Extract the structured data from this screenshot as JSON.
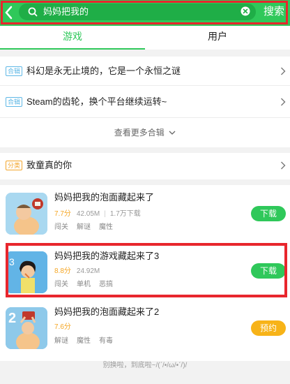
{
  "header": {
    "search_query": "妈妈把我的",
    "search_button": "搜索"
  },
  "tabs": [
    {
      "label": "游戏",
      "active": true
    },
    {
      "label": "用户",
      "active": false
    }
  ],
  "collections": [
    {
      "tag": "合辑",
      "title": "科幻是永无止境的，它是一个永恒之谜"
    },
    {
      "tag": "合辑",
      "title": "Steam的齿轮，换个平台继续运转~"
    }
  ],
  "more_collections": "查看更多合辑",
  "category": {
    "tag": "分类",
    "title": "致童真的你"
  },
  "games": [
    {
      "name": "妈妈把我的泡面藏起来了",
      "score": "7.7分",
      "size": "42.05M",
      "downloads": "1.7万下载",
      "tags": [
        "闯关",
        "解谜",
        "魔性"
      ],
      "action": "下载",
      "action_type": "download"
    },
    {
      "name": "妈妈把我的游戏藏起来了3",
      "score": "8.8分",
      "size": "24.92M",
      "downloads": "",
      "tags": [
        "闯关",
        "单机",
        "恶搞"
      ],
      "action": "下载",
      "action_type": "download"
    },
    {
      "name": "妈妈把我的泡面藏起来了2",
      "score": "7.6分",
      "size": "",
      "downloads": "",
      "tags": [
        "解谜",
        "魔性",
        "有毒"
      ],
      "action": "预约",
      "action_type": "reserve"
    }
  ],
  "footer": "别换啦，到底啦~/(ˊ/•/ω/•ˊ/)/",
  "colors": {
    "brand_green": "#2fc85a",
    "highlight_red": "#e8262d",
    "score_orange": "#f5a623",
    "reserve_yellow": "#f7b318"
  }
}
